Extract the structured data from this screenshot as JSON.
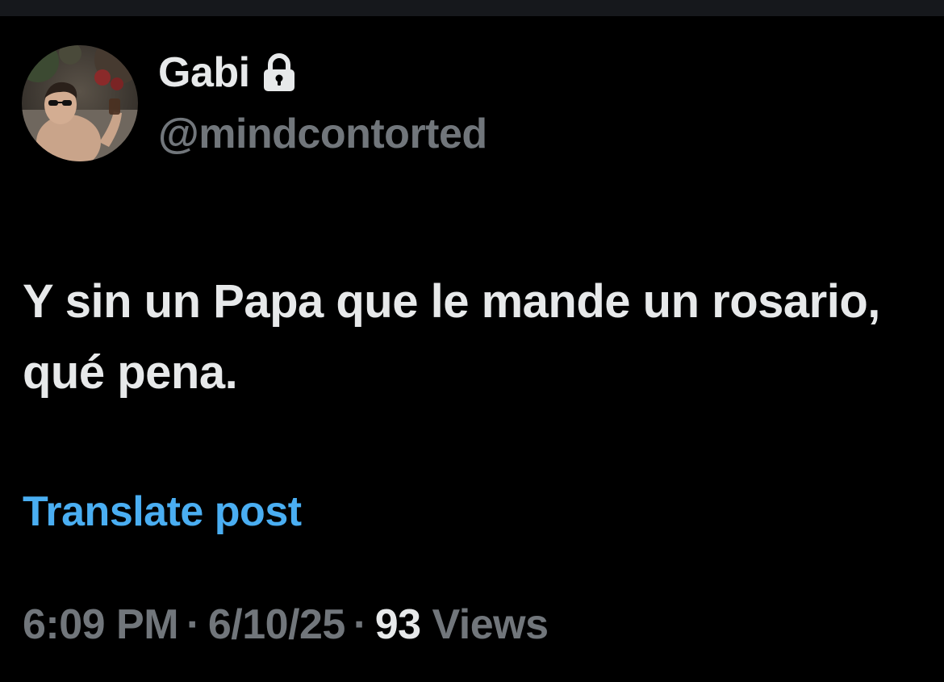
{
  "colors": {
    "background": "#000000",
    "primary_text": "#e7e9ea",
    "secondary_text": "#71767b",
    "link": "#4aaef2"
  },
  "author": {
    "display_name": "Gabi",
    "handle": "@mindcontorted",
    "protected_icon": "lock-icon",
    "avatar_icon": "avatar-photo"
  },
  "post": {
    "text": "Y sin un Papa que le mande un rosario, qué pena.",
    "translate_label": "Translate post"
  },
  "meta": {
    "time": "6:09 PM",
    "separator": "·",
    "date": "6/10/25",
    "views_count": "93",
    "views_label": "Views"
  }
}
